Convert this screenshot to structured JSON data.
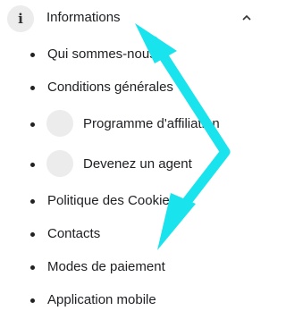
{
  "header": {
    "title": "Informations",
    "info_icon": "i"
  },
  "items": [
    {
      "label": "Qui sommes-nous"
    },
    {
      "label": "Conditions générales"
    },
    {
      "label": "Programme d'affiliation"
    },
    {
      "label": "Devenez un agent"
    },
    {
      "label": "Politique des Cookies"
    },
    {
      "label": "Contacts"
    },
    {
      "label": "Modes de paiement"
    },
    {
      "label": "Application mobile"
    }
  ],
  "annotation": {
    "arrow_color": "#19e3ec"
  }
}
